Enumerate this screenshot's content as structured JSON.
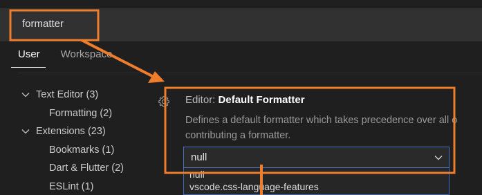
{
  "search": {
    "value": "formatter"
  },
  "tabs": [
    {
      "label": "User",
      "active": true
    },
    {
      "label": "Workspace",
      "active": false
    }
  ],
  "toc": [
    {
      "label": "Text Editor (3)",
      "level": 1,
      "expanded": true
    },
    {
      "label": "Formatting (2)",
      "level": 2
    },
    {
      "label": "Extensions (23)",
      "level": 1,
      "expanded": true
    },
    {
      "label": "Bookmarks (1)",
      "level": 2
    },
    {
      "label": "Dart & Flutter (2)",
      "level": 2
    },
    {
      "label": "ESLint (1)",
      "level": 2
    }
  ],
  "setting": {
    "category": "Editor: ",
    "name": "Default Formatter",
    "description_line1": "Defines a default formatter which takes precedence over all o",
    "description_line2": "contributing a formatter.",
    "selected_value": "null",
    "options": [
      "null",
      "vscode.css-language-features"
    ]
  },
  "colors": {
    "annotation": "#ef7d2b",
    "focus_border": "#4a73c4",
    "background": "#1f1f1f"
  },
  "icons": {
    "gear": "gear-icon",
    "chevron": "chevron-down-icon"
  }
}
